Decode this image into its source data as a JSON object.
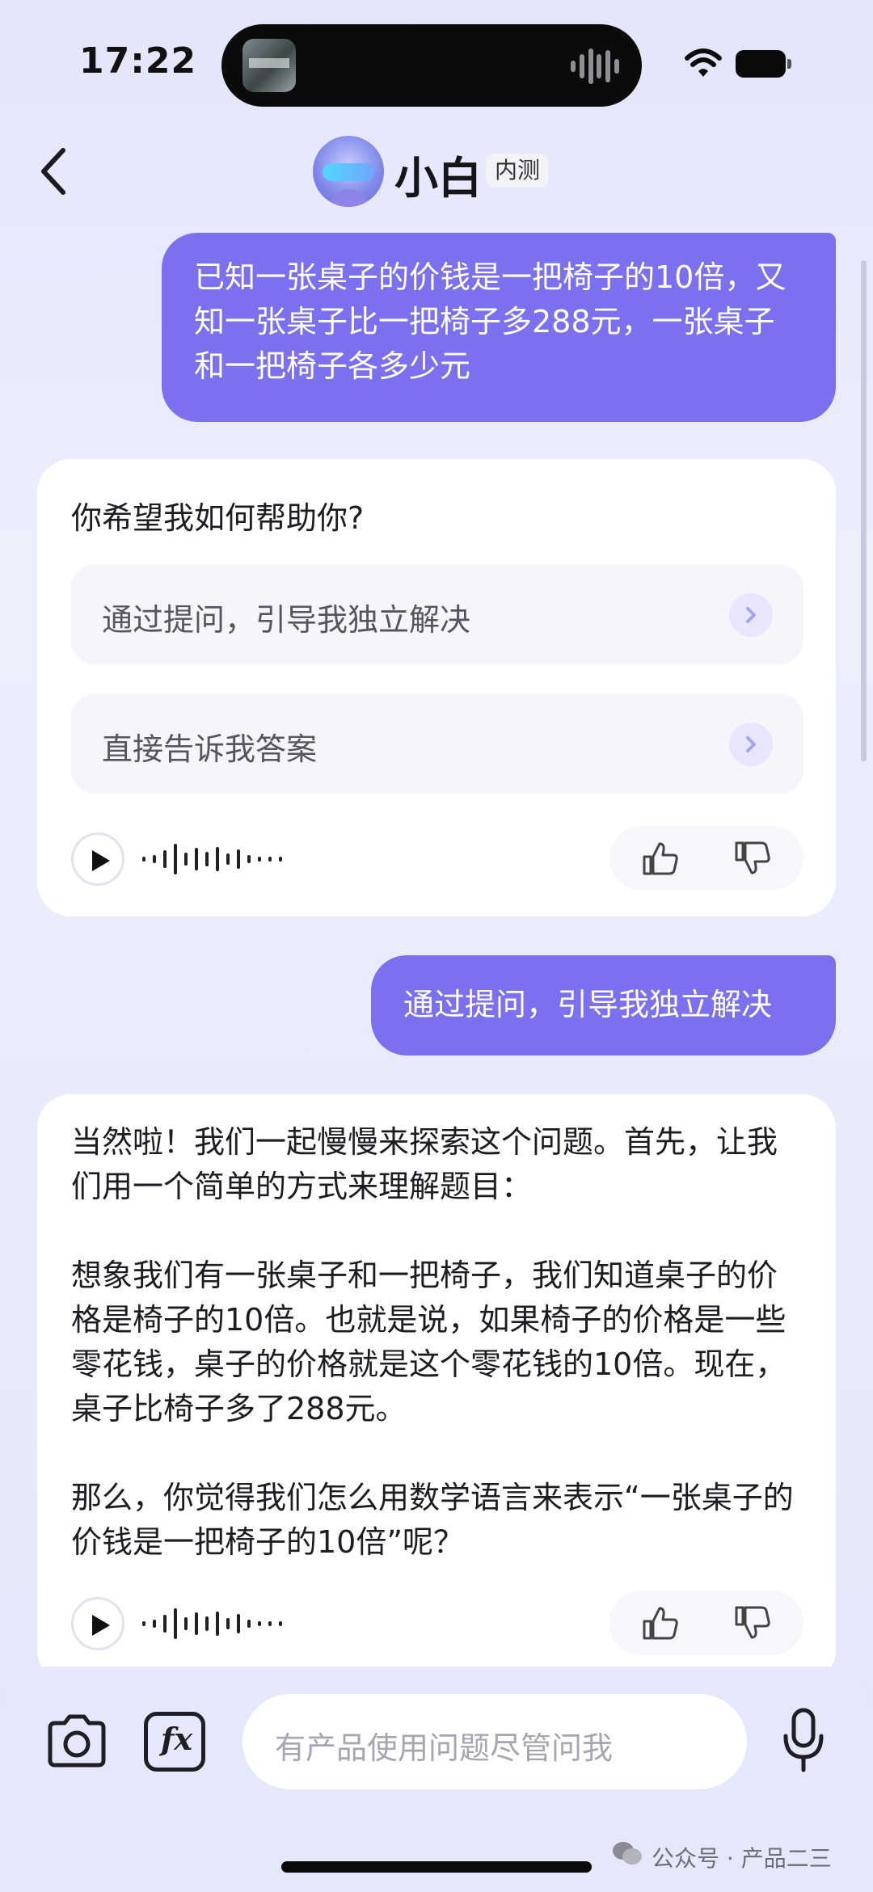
{
  "status_bar": {
    "time": "17:22"
  },
  "header": {
    "title": "小白",
    "badge": "内测"
  },
  "messages": {
    "user_1": "已知一张桌子的价钱是一把椅子的10倍，又知一张桌子比一把椅子多288元，一张桌子和一把椅子各多少元",
    "ai_1": {
      "prompt": "你希望我如何帮助你?",
      "options": [
        "通过提问，引导我独立解决",
        "直接告诉我答案"
      ]
    },
    "user_2": "通过提问，引导我独立解决",
    "ai_2": {
      "paragraphs": [
        "当然啦！我们一起慢慢来探索这个问题。首先，让我们用一个简单的方式来理解题目：",
        "想象我们有一张桌子和一把椅子，我们知道桌子的价格是椅子的10倍。也就是说，如果椅子的价格是一些零花钱，桌子的价格就是这个零花钱的10倍。现在，桌子比椅子多了288元。",
        "那么，你觉得我们怎么用数学语言来表示“一张桌子的价钱是一把椅子的10倍”呢？"
      ]
    }
  },
  "input": {
    "placeholder": "有产品使用问题尽管问我"
  },
  "watermark": "公众号 · 产品二三",
  "icons": {
    "back": "chevron-left-icon",
    "camera": "camera-icon",
    "formula": "fx-icon",
    "mic": "microphone-icon",
    "play": "play-icon",
    "like": "thumb-up-icon",
    "dislike": "thumb-down-icon"
  },
  "colors": {
    "accent": "#7b70ee",
    "background": "#e7e9fb"
  }
}
